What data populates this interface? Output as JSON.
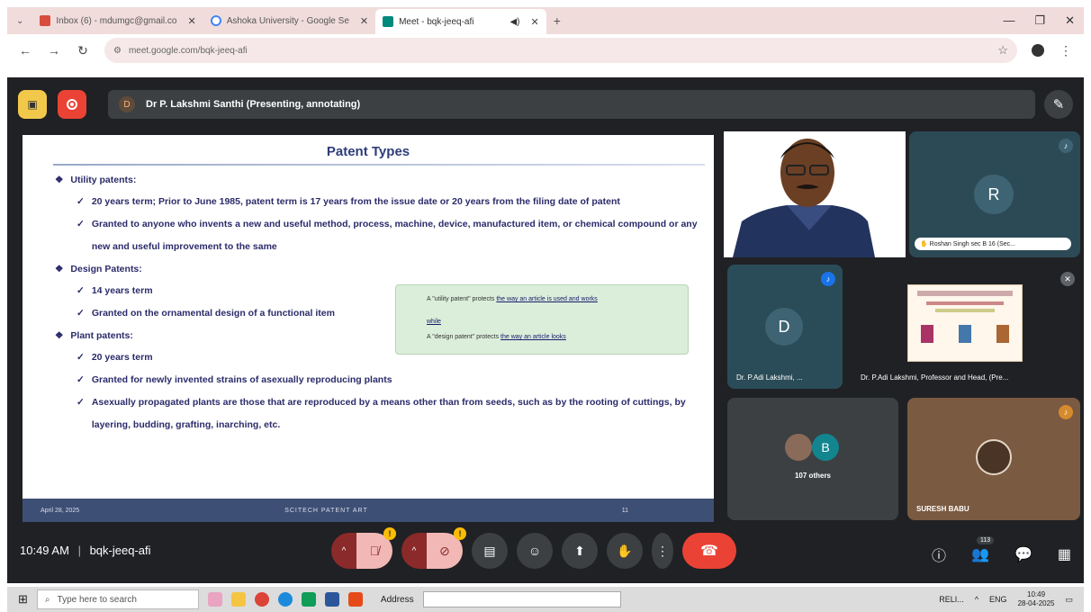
{
  "browser": {
    "tabs": [
      {
        "label": "Inbox (6) - mdumgc@gmail.co",
        "icon": "gmail-icon",
        "active": false
      },
      {
        "label": "Ashoka University - Google Se",
        "icon": "google-icon",
        "active": false
      },
      {
        "label": "Meet - bqk-jeeq-afi",
        "icon": "meet-icon",
        "active": true
      }
    ],
    "new_tab": "+",
    "url": "meet.google.com/bqk-jeeq-afi"
  },
  "meet": {
    "presenter_initial": "D",
    "presenter_label": "Dr P. Lakshmi Santhi (Presenting, annotating)",
    "slide": {
      "title": "Patent Types",
      "sections": [
        {
          "heading": "Utility patents:",
          "bullets": [
            "20 years term; Prior to June 1985,  patent term is 17 years from the issue date or 20 years from the filing date of patent",
            "Granted to anyone who invents a new and useful method, process, machine, device, manufactured item, or chemical compound or any new and useful improvement to the same"
          ]
        },
        {
          "heading": "Design Patents:",
          "bullets": [
            "14 years term",
            "Granted on the ornamental design of a functional item"
          ]
        },
        {
          "heading": "Plant patents:",
          "bullets": [
            "20 years term",
            "Granted for newly invented strains of asexually reproducing plants",
            "Asexually propagated plants are those that are reproduced by a means other than from seeds, such as by the rooting of cuttings, by layering, budding, grafting, inarching, etc."
          ]
        }
      ],
      "note": {
        "line1_pre": "A \"utility patent\" protects ",
        "line1_link": "the way an article is used and works",
        "line2": "while",
        "line3_pre": "A \"design patent\" protects ",
        "line3_link": "the way an article looks"
      },
      "footer_date": "April 28, 2025",
      "footer_center": "SCITECH PATENT ART",
      "footer_page": "11"
    },
    "participants": [
      {
        "name": "Roshan Singh sec B 16 (Sec...",
        "initial": "R"
      },
      {
        "name": "Dr. P.Adi Lakshmi, ...",
        "initial": "D"
      },
      {
        "name": "Dr. P.Adi Lakshmi, Professor and Head, (Pre..."
      },
      {
        "name": "107 others",
        "initial": "B"
      },
      {
        "name": "SURESH BABU"
      }
    ],
    "time": "10:49 AM",
    "meeting_code": "bqk-jeeq-afi",
    "people_count": "113"
  },
  "taskbar": {
    "search_placeholder": "Type here to search",
    "address_label": "Address",
    "tray_text": "RELI...",
    "lang": "ENG",
    "clock_time": "10:49",
    "clock_date": "28-04-2025"
  },
  "colors": {
    "accent_red": "#ea4335",
    "meet_bg": "#202124",
    "slide_footer": "#3d4f74"
  }
}
